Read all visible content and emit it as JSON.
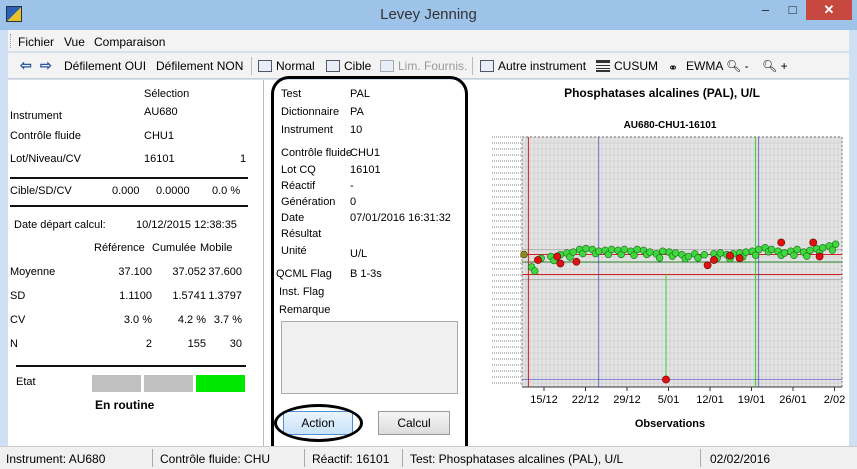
{
  "window": {
    "title": "Levey Jenning",
    "min": "–",
    "max": "□",
    "close": "✕"
  },
  "menu": [
    "Fichier",
    "Vue",
    "Comparaison"
  ],
  "toolbar": {
    "back_icon": "arrow-left-icon",
    "forward_icon": "arrow-right-icon",
    "scroll_yes": "Défilement OUI",
    "scroll_no": "Défilement NON",
    "normal": "Normal",
    "target": "Cible",
    "supplier_limits": "Lim. Fournis.",
    "other_instrument": "Autre instrument",
    "cusum": "CUSUM",
    "ewma": "EWMA",
    "zoom_out": "-",
    "zoom_in": "+"
  },
  "left": {
    "selection_header": "Sélection",
    "instrument_label": "Instrument",
    "instrument_value": "AU680",
    "control_label": "Contrôle fluide",
    "control_value": "CHU1",
    "lot_label": "Lot/Niveau/CV",
    "lot_value": "16101",
    "level_value": "1",
    "target_label": "Cible/SD/CV",
    "target_value": "0.000",
    "target_sd": "0.0000",
    "target_cv": "0.0 %",
    "start_label": "Date départ calcul:",
    "start_value": "10/12/2015 12:38:35",
    "col_ref": "Référence",
    "col_cum": "Cumulée",
    "col_mob": "Mobile",
    "rows": [
      {
        "label": "Moyenne",
        "ref": "37.100",
        "cum": "37.052",
        "mob": "37.600"
      },
      {
        "label": "SD",
        "ref": "1.1100",
        "cum": "1.5741",
        "mob": "1.3797"
      },
      {
        "label": "CV",
        "ref": "3.0 %",
        "cum": "4.2 %",
        "mob": "3.7 %"
      },
      {
        "label": "N",
        "ref": "2",
        "cum": "155",
        "mob": "30"
      }
    ],
    "state_label": "Etat",
    "state_text": "En routine",
    "state_colors": [
      "#c0c0c0",
      "#c0c0c0",
      "#00e800"
    ]
  },
  "center": {
    "test_label": "Test",
    "test_value": "PAL",
    "dict_label": "Dictionnaire",
    "dict_value": "PA",
    "inst_label": "Instrument",
    "inst_value": "10",
    "ctrl_label": "Contrôle fluide",
    "ctrl_value": "CHU1",
    "lot_label": "Lot CQ",
    "lot_value": "16101",
    "reagent_label": "Réactif",
    "reagent_value": "-",
    "gen_label": "Génération",
    "gen_value": "0",
    "date_label": "Date",
    "date_value": "07/01/2016 16:31:32",
    "result_label": "Résultat",
    "unit_label": "Unité",
    "unit_value": "U/L",
    "qcml_label": "QCML Flag",
    "qcml_value": "B 1-3s",
    "inst_flag_label": "Inst. Flag",
    "remark_label": "Remarque",
    "action_button": "Action",
    "calc_button": "Calcul"
  },
  "chart_data": {
    "type": "scatter",
    "title": "Phosphatases alcalines (PAL), U/L",
    "subtitle": "AU680-CHU1-16101",
    "xlabel": "Observations",
    "x_tick_labels": [
      "15/12",
      "22/12",
      "29/12",
      "5/01",
      "12/01",
      "19/01",
      "26/01",
      "2/02"
    ],
    "colors": {
      "in_control": "#3fd83f",
      "out_of_control": "#e01010",
      "mean_line": "#2a8a2a",
      "limit_line": "#d02020",
      "red_marker": "#d02020",
      "green_marker": "#30d030",
      "blue_marker": "#3030c0"
    },
    "green_marker_position": 0.39,
    "red_marker_position": 0.02,
    "blue_marker_position": 0.24,
    "series_green": [
      0.03,
      0.06,
      0.09,
      0.12,
      0.14,
      0.16,
      0.18,
      0.2,
      0.22,
      0.24,
      0.26,
      0.28,
      0.3,
      0.32,
      0.34,
      0.36,
      0.38,
      0.4,
      0.42,
      0.44,
      0.46,
      0.48,
      0.5,
      0.52,
      0.54,
      0.57,
      0.6,
      0.62,
      0.64,
      0.66,
      0.68,
      0.7,
      0.72,
      0.74,
      0.76,
      0.78,
      0.8,
      0.82,
      0.84,
      0.86,
      0.88,
      0.9,
      0.92,
      0.94,
      0.96,
      0.98
    ],
    "series_green_y": [
      0.5,
      0.4,
      0.38,
      0.36,
      0.34,
      0.33,
      0.3,
      0.29,
      0.3,
      0.32,
      0.31,
      0.3,
      0.31,
      0.3,
      0.32,
      0.3,
      0.31,
      0.33,
      0.35,
      0.32,
      0.33,
      0.34,
      0.36,
      0.38,
      0.35,
      0.36,
      0.35,
      0.34,
      0.36,
      0.35,
      0.34,
      0.33,
      0.32,
      0.3,
      0.28,
      0.3,
      0.32,
      0.34,
      0.32,
      0.3,
      0.33,
      0.31,
      0.29,
      0.28,
      0.26,
      0.24
    ],
    "series_red_x": [
      0.05,
      0.11,
      0.12,
      0.17,
      0.45,
      0.58,
      0.6,
      0.65,
      0.68,
      0.81,
      0.91,
      0.93
    ],
    "series_red_y": [
      0.42,
      0.38,
      0.46,
      0.44,
      0.97,
      0.48,
      0.42,
      0.37,
      0.4,
      0.22,
      0.22,
      0.38
    ]
  },
  "status": {
    "instrument": "Instrument: AU680",
    "control": "Contrôle fluide: CHU1",
    "reagent": "Réactif: 16101",
    "test": "Test: Phosphatases alcalines (PAL), U/L",
    "date": "02/02/2016"
  }
}
